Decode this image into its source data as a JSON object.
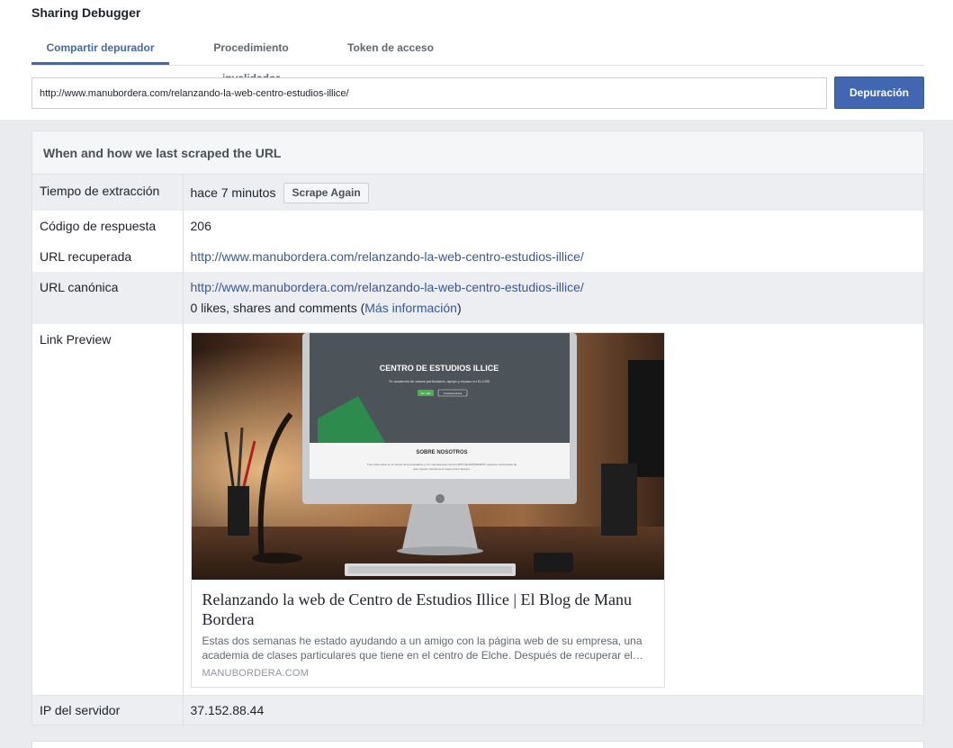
{
  "app": {
    "title": "Sharing Debugger"
  },
  "tabs": [
    {
      "label": "Compartir depurador",
      "active": true
    },
    {
      "label": "Procedimiento invalidador",
      "active": false
    },
    {
      "label": "Token de acceso",
      "active": false
    }
  ],
  "search": {
    "value": "http://www.manubordera.com/relanzando-la-web-centro-estudios-illice/",
    "button_label": "Depuración"
  },
  "panel": {
    "title": "When and how we last scraped the URL",
    "rows": {
      "time": {
        "label": "Tiempo de extracción",
        "value": "hace 7 minutos",
        "button": "Scrape Again"
      },
      "code": {
        "label": "Código de respuesta",
        "value": "206"
      },
      "fetched": {
        "label": "URL recuperada",
        "value": "http://www.manubordera.com/relanzando-la-web-centro-estudios-illice/"
      },
      "canonical": {
        "label": "URL canónica",
        "value": "http://www.manubordera.com/relanzando-la-web-centro-estudios-illice/",
        "likes_text": "0 likes, shares and comments (",
        "more_link": "Más información",
        "likes_close": ")"
      },
      "preview": {
        "label": "Link Preview"
      },
      "ip": {
        "label": "IP del servidor",
        "value": "37.152.88.44"
      }
    }
  },
  "preview_card": {
    "image": {
      "screen_heading": "CENTRO DE ESTUDIOS ILLICE",
      "screen_sub": "Tu academia de clases particulares, apoyo y repaso en ELCHE",
      "screen_btn1": "Ver más",
      "screen_btn2": "Contacta ahora",
      "screen_section": "SOBRE NOSOTROS",
      "screen_text1": "Tras varios años en el mundo de la enseñanza y con una tasa que roza el 100% DE APROBADOS, estamos convencidos de",
      "screen_text2": "que nuestro método es el mejor para tí alumno."
    },
    "title": "Relanzando la web de Centro de Estudios Illice | El Blog de Manu Bordera",
    "description": "Estas dos semanas he estado ayudando a un amigo con la página web de su empresa, una academia de clases particulares que tiene en el centro de Elche. Después de recuperar el…",
    "domain": "MANUBORDERA.COM"
  },
  "colors": {
    "accent": "#4267b2",
    "link": "#365899",
    "shade": "#eceef1"
  }
}
